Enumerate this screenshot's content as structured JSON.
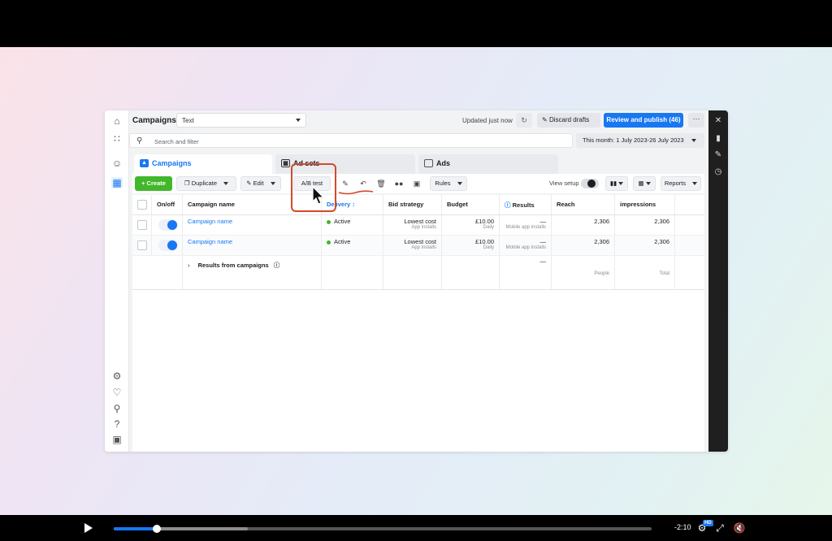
{
  "header": {
    "title": "Campaigns",
    "select_value": "Text",
    "updated": "Updated just now",
    "discard": "Discard drafts",
    "publish": "Review and publish (46)",
    "more": "···"
  },
  "search": {
    "placeholder": "Search and filter"
  },
  "daterange": "This month: 1 July 2023-26 July 2023",
  "tabs": [
    {
      "label": "Campaigns",
      "active": true
    },
    {
      "label": "Ad sets",
      "active": false
    },
    {
      "label": "Ads",
      "active": false
    }
  ],
  "toolbar": {
    "create": "+ Create",
    "duplicate": "Duplicate",
    "edit": "Edit",
    "abtest": "A/B test",
    "rules": "Rules",
    "view_setup": "View setup",
    "reports": "Reports"
  },
  "table": {
    "headers": [
      "On/off",
      "Campaign name",
      "Delivery ↕",
      "Bid strategy",
      "Budget",
      "Results",
      "Reach",
      "impressions"
    ],
    "rows": [
      {
        "name": "Campaign name",
        "delivery": "Active",
        "bid": "Lowest cost",
        "bid_sub": "App installs",
        "budget": "£10.00",
        "budget_sub": "Daily",
        "results": "—",
        "results_sub": "Mobile app installs",
        "reach": "2,306",
        "impressions": "2,306"
      },
      {
        "name": "Campaign name",
        "delivery": "Active",
        "bid": "Lowest cost",
        "bid_sub": "App installs",
        "budget": "£10.00",
        "budget_sub": "Daily",
        "results": "—",
        "results_sub": "Mobile app installs",
        "reach": "2,306",
        "impressions": "2,306"
      }
    ],
    "summary": {
      "label": "Results from campaigns",
      "results": "—",
      "reach_sub": "People",
      "impressions_sub": "Total"
    }
  },
  "player": {
    "time": "-2:10",
    "hd": "HD",
    "progress": 0.08
  },
  "colors": {
    "accent": "#1877f2",
    "create": "#42b72a",
    "annotation": "#d24a2a"
  }
}
